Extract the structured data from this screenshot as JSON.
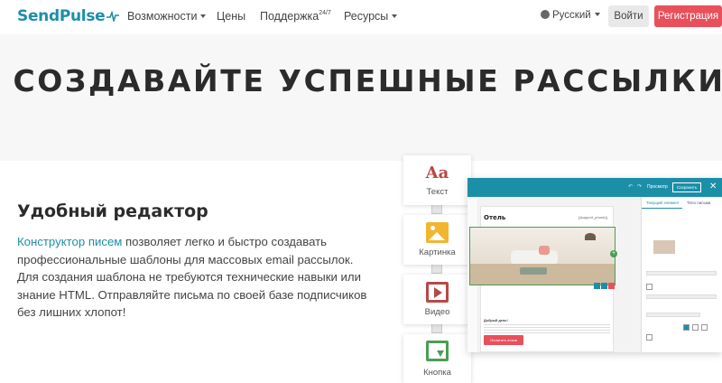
{
  "nav": {
    "logo": "SendPulse",
    "items": [
      {
        "label": "Возможности",
        "caret": true
      },
      {
        "label": "Цены",
        "caret": false
      },
      {
        "label": "Поддержка",
        "sup": "24/7",
        "caret": false
      },
      {
        "label": "Ресурсы",
        "caret": true
      }
    ],
    "language": "Русский",
    "login": "Войти",
    "register": "Регистрация"
  },
  "hero": {
    "title": "СОЗДАВАЙТЕ УСПЕШНЫЕ РАССЫЛКИ"
  },
  "feature": {
    "title": "Удобный редактор",
    "link_text": "Конструктор писем",
    "text": " позволяет легко и быстро создавать профессиональные шаблоны для массовых email рассылок. Для создания шаблона не требуются технические навыки или знание HTML. Отправляйте письма по своей базе подписчиков без лишних хлопот!"
  },
  "tools": {
    "text_icon": "Aa",
    "text": "Текст",
    "image": "Картинка",
    "video": "Видео",
    "button": "Кнопка"
  },
  "editor": {
    "doc_title": "Отель",
    "phone_placeholder": "{{support_phone}}",
    "greeting": "Добрый день!",
    "cta": "Оплатить отзыв",
    "preview": "Просмотр",
    "save": "Сохранить",
    "tab1": "Текущий элемент",
    "tab2": "Тело письма"
  },
  "colors": {
    "brand": "#1c8fa8",
    "accent": "#e8505b"
  }
}
